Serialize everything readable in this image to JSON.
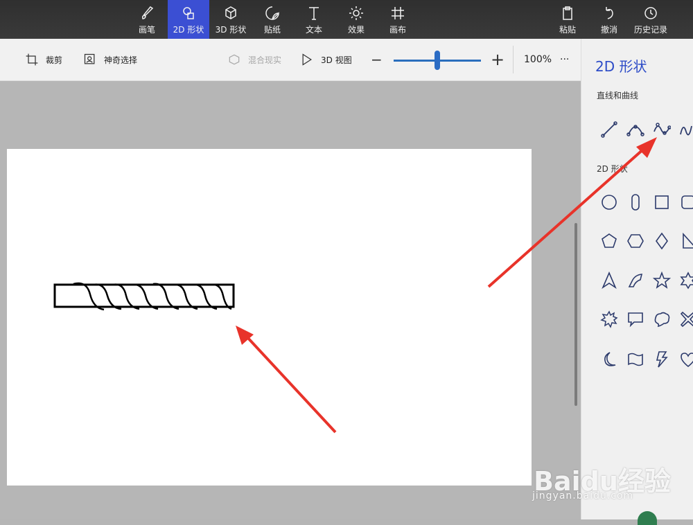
{
  "top_tools": {
    "brush": "画笔",
    "shapes2d": "2D 形状",
    "shapes3d": "3D 形状",
    "stickers": "贴纸",
    "text": "文本",
    "effects": "效果",
    "canvas": "画布",
    "paste": "粘贴",
    "undo": "撤消",
    "history": "历史记录"
  },
  "toolbar2": {
    "crop": "裁剪",
    "magic_select": "神奇选择",
    "mixed_reality": "混合现实",
    "view3d": "3D 视图",
    "zoom_minus": "−",
    "zoom_plus": "+",
    "zoom_value": "100%",
    "more": "···"
  },
  "panel": {
    "title": "2D 形状",
    "lines_section": "直线和曲线",
    "shapes_section": "2D 形状"
  },
  "watermark": {
    "brand": "Baidu经验",
    "url": "jingyan.baidu.com"
  },
  "colors": {
    "accent": "#3b4fd3",
    "arrow": "#e8332a"
  }
}
